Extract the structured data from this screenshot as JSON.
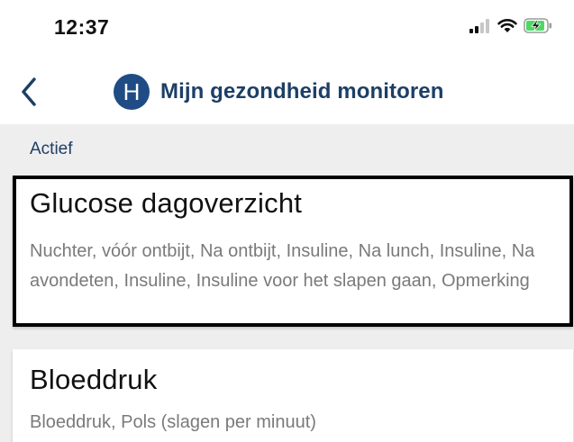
{
  "status_bar": {
    "time": "12:37",
    "icons": [
      "signal-icon",
      "wifi-icon",
      "battery-charging-icon"
    ]
  },
  "header": {
    "back_icon": "chevron-left-icon",
    "avatar_letter": "H",
    "title": "Mijn gezondheid monitoren",
    "colors": {
      "avatar": "#1f4c85",
      "title": "#1d3f66"
    }
  },
  "section": {
    "label": "Actief"
  },
  "cards": [
    {
      "title": "Glucose dagoverzicht",
      "description": "Nuchter, vóór ontbijt, Na ontbijt, Insuline, Na lunch, Insuline, Na avondeten, Insuline, Insuline voor het slapen gaan, Opmerking",
      "selected": true
    },
    {
      "title": "Bloeddruk",
      "description": "Bloeddruk, Pols (slagen per minuut)",
      "selected": false
    }
  ]
}
